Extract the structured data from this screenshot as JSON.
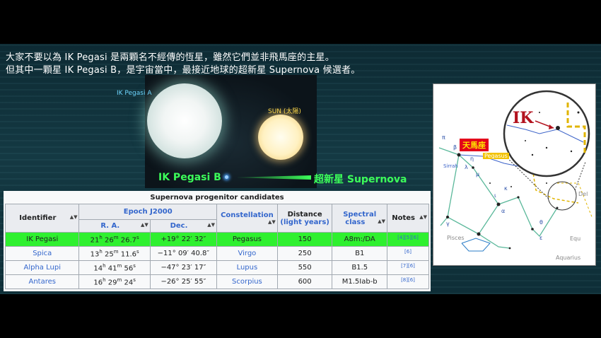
{
  "captions": {
    "line1": "大家不要以為 IK Pegasi 是兩顆名不經傳的恆星，雖然它們並非飛馬座的主星。",
    "line2": "但其中一顆星 IK Pegasi B，是宇宙當中，最接近地球的超新星 Supernova 候選者。"
  },
  "illustration": {
    "star_a_label": "IK Pegasi A",
    "sun_label": "SUN (太陽)",
    "star_b_label": "IK Pegasi B",
    "supernova_label": "超新星 Supernova"
  },
  "table": {
    "title": "Supernova progenitor candidates",
    "headers": {
      "identifier": "Identifier",
      "epoch": "Epoch J2000",
      "ra": "R. A.",
      "dec": "Dec.",
      "constellation": "Constellation",
      "distance": "Distance",
      "distance_unit": "(light years)",
      "spectral": "Spectral",
      "spectral2": "class",
      "notes": "Notes",
      "sort_glyph": "▲▼"
    },
    "rows": [
      {
        "identifier": "IK Pegasi",
        "ra_h": "21",
        "ra_m": "26",
        "ra_s": "26.7",
        "dec": "+19° 22′ 32″",
        "constellation": "Pegasus",
        "distance": "150",
        "spectral": "A8m:/DA",
        "notes": "[4][5][6]"
      },
      {
        "identifier": "Spica",
        "ra_h": "13",
        "ra_m": "25",
        "ra_s": "11.6",
        "dec": "−11° 09′ 40.8″",
        "constellation": "Virgo",
        "distance": "250",
        "spectral": "B1",
        "notes": "[6]"
      },
      {
        "identifier": "Alpha Lupi",
        "ra_h": "14",
        "ra_m": "41",
        "ra_s": "56",
        "dec": "−47° 23′ 17″",
        "constellation": "Lupus",
        "distance": "550",
        "spectral": "B1.5",
        "notes": "[7][6]"
      },
      {
        "identifier": "Antares",
        "ra_h": "16",
        "ra_m": "29",
        "ra_s": "24",
        "dec": "−26° 25′ 55″",
        "constellation": "Scorpius",
        "distance": "600",
        "spectral": "M1.5Iab-b",
        "notes": "[8][6]"
      }
    ],
    "unit_h": "h",
    "unit_m": "m",
    "unit_s": "s"
  },
  "map": {
    "ik_label": "IK",
    "constellation_label": "天馬座",
    "pegasus_label": "Pegasus",
    "pisces_label": "Pisces",
    "aquarius_label": "Aquarius",
    "equ_label": "Equ",
    "del_label": "Del",
    "sirrah_label": "Sirrah",
    "greek": [
      "π",
      "η",
      "β",
      "μ",
      "λ",
      "ι",
      "κ",
      "α",
      "θ",
      "ε",
      "γ"
    ]
  },
  "colors": {
    "highlight": "#2ff02f",
    "label_green": "#3cff5a",
    "ik_red": "#b3121e",
    "pegasus_yellow": "#f2c200"
  }
}
